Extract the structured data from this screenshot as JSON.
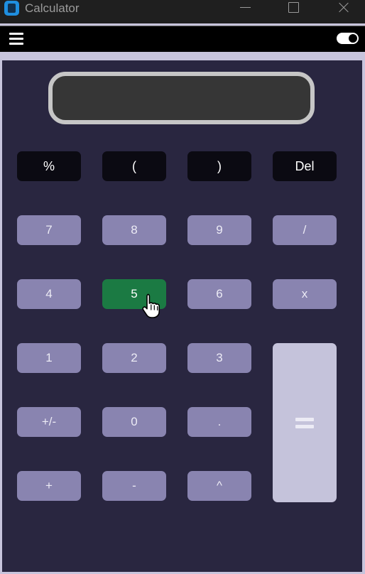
{
  "window": {
    "title": "Calculator",
    "controls": [
      "minimize",
      "maximize",
      "close"
    ]
  },
  "appbar": {
    "menu_icon": "hamburger-menu-icon",
    "theme_toggle": {
      "icon": "toggle-switch-icon",
      "state": "on"
    }
  },
  "display": {
    "value": ""
  },
  "keys": {
    "percent": "%",
    "open_paren": "(",
    "close_paren": ")",
    "delete": "Del",
    "seven": "7",
    "eight": "8",
    "nine": "9",
    "divide": "/",
    "four": "4",
    "five": "5",
    "six": "6",
    "multiply": "x",
    "one": "1",
    "two": "2",
    "three": "3",
    "negate": "+/-",
    "zero": "0",
    "decimal": ".",
    "plus": "+",
    "minus": "-",
    "power": "^",
    "equals_icon": "equals-icon"
  },
  "colors": {
    "panel": "#292640",
    "function_key": "#0b0a12",
    "number_key": "#8984b0",
    "active_key": "#1b7a43",
    "equals_key": "#c5c3db",
    "display": "#363636",
    "display_border": "#c6c6c6"
  }
}
